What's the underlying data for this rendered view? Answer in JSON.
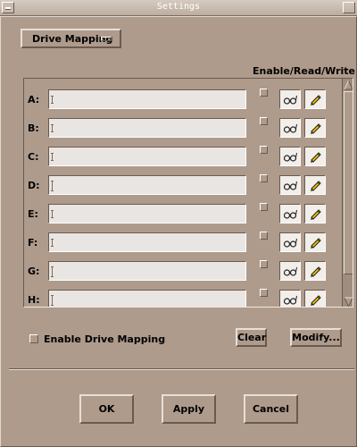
{
  "window": {
    "title": "Settings"
  },
  "mode_menu": {
    "selected": "Drive Mapping"
  },
  "header": {
    "enable_read_write": "Enable/Read/Write"
  },
  "drives": [
    {
      "letter": "A:",
      "path": ""
    },
    {
      "letter": "B:",
      "path": ""
    },
    {
      "letter": "C:",
      "path": ""
    },
    {
      "letter": "D:",
      "path": ""
    },
    {
      "letter": "E:",
      "path": ""
    },
    {
      "letter": "F:",
      "path": ""
    },
    {
      "letter": "G:",
      "path": ""
    },
    {
      "letter": "H:",
      "path": ""
    }
  ],
  "options": {
    "enable_drive_mapping_label": "Enable Drive Mapping",
    "enable_drive_mapping_checked": false
  },
  "actions": {
    "clear_label": "Clear",
    "modify_label": "Modify..."
  },
  "footer": {
    "ok_label": "OK",
    "apply_label": "Apply",
    "cancel_label": "Cancel"
  },
  "icons": {
    "read": "glasses-icon",
    "write": "pencil-icon"
  },
  "colors": {
    "background": "#ae9b8c",
    "field": "#e9e5e2",
    "pencil": "#f2c400"
  }
}
